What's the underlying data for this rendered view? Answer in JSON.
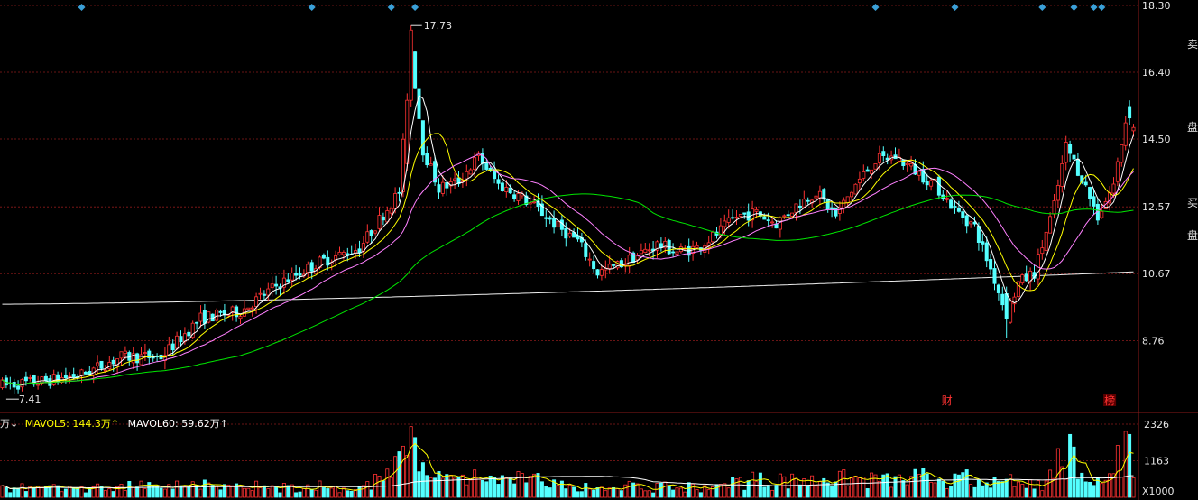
{
  "colors": {
    "up": "#ff3232",
    "down": "#54ffff",
    "ma5": "#ffffff",
    "ma10": "#ffff00",
    "ma20": "#ff80ff",
    "ma60": "#00e600",
    "ma250": "#f0f0f0",
    "grid": "#8c1a1a",
    "axis_text": "#e6e6e6",
    "marker": "#3aa0d8"
  },
  "chart_data": {
    "type": "candlestick",
    "price_axis": {
      "ticks": [
        18.3,
        16.4,
        14.5,
        12.57,
        10.67,
        8.76
      ],
      "ylim": [
        6.85,
        18.3
      ]
    },
    "volume_axis": {
      "ticks": [
        2326,
        1163
      ],
      "unit_label": "X1000",
      "ylim": [
        0,
        2326
      ]
    },
    "annotations": {
      "high_label": "17.73",
      "low_label": "7.41"
    },
    "event_labels": [
      "财",
      "榜"
    ],
    "side_labels": [
      "卖",
      "盘",
      "买",
      "盘"
    ],
    "volume_legend": {
      "partial_unit": "万↓",
      "mavol5_label": "MAVOL5:",
      "mavol5_value": "144.3万↑",
      "mavol60_label": "MAVOL60:",
      "mavol60_value": "59.62万↑"
    },
    "anchors": [
      [
        0,
        7.5
      ],
      [
        10,
        7.6
      ],
      [
        20,
        7.8
      ],
      [
        30,
        8.3
      ],
      [
        40,
        8.3
      ],
      [
        50,
        9.4
      ],
      [
        60,
        9.6
      ],
      [
        70,
        10.4
      ],
      [
        80,
        11.0
      ],
      [
        90,
        11.4
      ],
      [
        95,
        12.2
      ],
      [
        100,
        13.0
      ],
      [
        103,
        17.0
      ],
      [
        106,
        14.2
      ],
      [
        110,
        13.1
      ],
      [
        115,
        13.3
      ],
      [
        120,
        14.0
      ],
      [
        125,
        13.2
      ],
      [
        130,
        12.9
      ],
      [
        135,
        12.5
      ],
      [
        140,
        12.0
      ],
      [
        145,
        11.6
      ],
      [
        150,
        10.7
      ],
      [
        155,
        10.9
      ],
      [
        160,
        11.2
      ],
      [
        165,
        11.5
      ],
      [
        170,
        11.3
      ],
      [
        175,
        11.4
      ],
      [
        180,
        11.8
      ],
      [
        185,
        12.3
      ],
      [
        190,
        12.4
      ],
      [
        195,
        12.1
      ],
      [
        200,
        12.6
      ],
      [
        205,
        13.0
      ],
      [
        210,
        12.3
      ],
      [
        215,
        13.2
      ],
      [
        220,
        13.9
      ],
      [
        225,
        14.0
      ],
      [
        230,
        13.6
      ],
      [
        235,
        13.2
      ],
      [
        240,
        12.5
      ],
      [
        245,
        12.0
      ],
      [
        250,
        10.5
      ],
      [
        253,
        9.5
      ],
      [
        256,
        10.4
      ],
      [
        260,
        10.7
      ],
      [
        265,
        12.6
      ],
      [
        268,
        14.3
      ],
      [
        272,
        13.4
      ],
      [
        276,
        12.3
      ],
      [
        280,
        13.2
      ],
      [
        283,
        15.0
      ],
      [
        285,
        14.8
      ]
    ],
    "volume_spikes": [
      [
        103,
        2250
      ],
      [
        104,
        1900
      ],
      [
        283,
        2100
      ],
      [
        284,
        2000
      ],
      [
        269,
        2000
      ],
      [
        266,
        1550
      ],
      [
        99,
        1300
      ],
      [
        100,
        1450
      ],
      [
        270,
        1600
      ],
      [
        281,
        1650
      ]
    ]
  }
}
